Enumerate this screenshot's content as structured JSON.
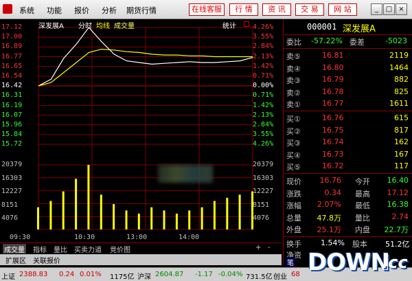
{
  "menu": {
    "items": [
      "系统",
      "功能",
      "报价",
      "分析",
      "期货行情"
    ],
    "red_buttons": [
      "在线客服",
      "行 情",
      "资 讯",
      "交 易",
      "网 站"
    ]
  },
  "chart": {
    "stock_name": "深发展A",
    "tab_timeshare": "分时",
    "legend_avg": "均线",
    "legend_vol": "成交量",
    "stat_label": "统计",
    "price_labels": [
      "17.12",
      "17.00",
      "16.89",
      "16.77",
      "16.65",
      "16.54",
      "16.42",
      "16.31",
      "16.19",
      "16.07",
      "15.96",
      "15.84",
      "15.72"
    ],
    "pct_labels": [
      "4.26%",
      "3.55%",
      "2.84%",
      "2.13%",
      "1.42%",
      "0.71%",
      "0.00%",
      "0.71%",
      "1.42%",
      "2.13%",
      "2.84%",
      "3.55%",
      "4.26%"
    ],
    "vol_labels": [
      "20379",
      "16303",
      "12227",
      "8151",
      "4076"
    ],
    "time_labels": [
      "09:30",
      "10:30",
      "13:00",
      "14:00"
    ],
    "colors": {
      "up": "#ff3333",
      "down": "#33ff33",
      "price_line": "#ffffff",
      "avg_line": "#ffff00",
      "grid": "#800000"
    }
  },
  "chart_data": {
    "type": "line",
    "title": "",
    "x": [
      "09:30",
      "09:45",
      "10:00",
      "10:15",
      "10:30",
      "10:45",
      "11:00",
      "11:15",
      "11:30",
      "13:00",
      "13:15",
      "13:30",
      "13:45",
      "14:00",
      "14:15",
      "14:30",
      "14:45",
      "15:00"
    ],
    "series": [
      {
        "name": "",
        "values": [
          16.42,
          16.5,
          16.75,
          16.92,
          17.12,
          16.95,
          16.8,
          16.72,
          16.7,
          16.68,
          16.69,
          16.7,
          16.71,
          16.7,
          16.7,
          16.71,
          16.72,
          16.76
        ]
      },
      {
        "name": "均线",
        "values": [
          16.42,
          16.46,
          16.58,
          16.7,
          16.82,
          16.86,
          16.85,
          16.83,
          16.82,
          16.8,
          16.79,
          16.79,
          16.78,
          16.78,
          16.77,
          16.77,
          16.77,
          16.77
        ]
      }
    ],
    "volume": [
      7000,
      9000,
      12000,
      16000,
      20379,
      11000,
      8000,
      6000,
      5000,
      7000,
      6000,
      5000,
      6000,
      7000,
      9000,
      10000,
      11000,
      12000
    ],
    "ylim": [
      15.72,
      17.12
    ],
    "vol_ylim": [
      0,
      20379
    ],
    "xlabel": "",
    "ylabel": ""
  },
  "tabs": {
    "row1": [
      "成交量",
      "指标",
      "量比",
      "买卖力道",
      "竞价图"
    ],
    "row1_controls": [
      "+",
      "-"
    ],
    "row2": [
      "扩展区",
      "关联报价"
    ]
  },
  "quote": {
    "code": "000001",
    "name": "深发展A",
    "weibi_label": "委比",
    "weibi_value": "-57.22%",
    "weicha_label": "委差",
    "weicha_value": "-5023",
    "sell": [
      {
        "label": "卖⑤",
        "price": "16.81",
        "vol": "2119"
      },
      {
        "label": "卖④",
        "price": "16.80",
        "vol": "1464"
      },
      {
        "label": "卖③",
        "price": "16.79",
        "vol": "882"
      },
      {
        "label": "卖②",
        "price": "16.78",
        "vol": "825"
      },
      {
        "label": "卖①",
        "price": "16.77",
        "vol": "1611"
      }
    ],
    "buy": [
      {
        "label": "买①",
        "price": "16.76",
        "vol": "615"
      },
      {
        "label": "买②",
        "price": "16.75",
        "vol": "817"
      },
      {
        "label": "买③",
        "price": "16.74",
        "vol": "162"
      },
      {
        "label": "买④",
        "price": "16.73",
        "vol": "167"
      },
      {
        "label": "买⑤",
        "price": "16.72",
        "vol": "117"
      }
    ],
    "stats": [
      {
        "l1": "现价",
        "v1": "16.76",
        "l2": "今开",
        "v2": "16.40"
      },
      {
        "l1": "涨跌",
        "v1": "0.34",
        "l2": "最高",
        "v2": "17.12"
      },
      {
        "l1": "涨幅",
        "v1": "2.07%",
        "l2": "最低",
        "v2": "16.38"
      },
      {
        "l1": "总量",
        "v1": "47.8万",
        "l2": "量比",
        "v2": "2.74"
      },
      {
        "l1": "外盘",
        "v1": "25.1万",
        "l2": "内盘",
        "v2": "22.7万"
      }
    ],
    "huanshou_label": "换手",
    "huanshou_value": "1.54%",
    "guben_label": "股本",
    "guben_value": "51.2亿",
    "extra_label": "净资"
  },
  "status": {
    "sh_label": "上证",
    "sh_value": "2388.83",
    "sh_change": "0.24",
    "sh_pct": "0.01%",
    "sh_amount": "1175亿",
    "sz_label": "沪深",
    "sz_value": "2604.87",
    "sz_change": "-1.17",
    "sz_pct": "-0.04%",
    "sz_amount": "731.5亿",
    "cy_label": "创业",
    "cy_value": "68",
    "bi_label": "笔"
  },
  "watermark": {
    "text": "DOWN",
    "suffix": ".cc"
  }
}
